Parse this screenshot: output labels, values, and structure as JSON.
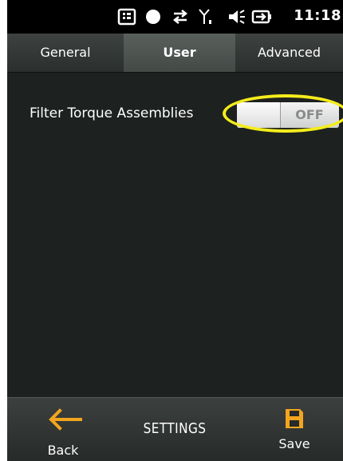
{
  "status_bar": {
    "time": "11:18",
    "icons": [
      "windows-start-icon",
      "record-dot-icon",
      "data-transfer-icon",
      "signal-icon",
      "speaker-icon",
      "battery-charging-icon"
    ]
  },
  "tabs": [
    {
      "label": "General",
      "active": false
    },
    {
      "label": "User",
      "active": true
    },
    {
      "label": "Advanced",
      "active": false
    }
  ],
  "settings": {
    "filter_label": "Filter Torque Assemblies",
    "filter_state": "OFF"
  },
  "bottom_bar": {
    "back_label": "Back",
    "title": "SETTINGS",
    "save_label": "Save"
  },
  "colors": {
    "accent": "#f3a51f",
    "highlight": "#f4ec1c",
    "background": "#1d211f"
  }
}
